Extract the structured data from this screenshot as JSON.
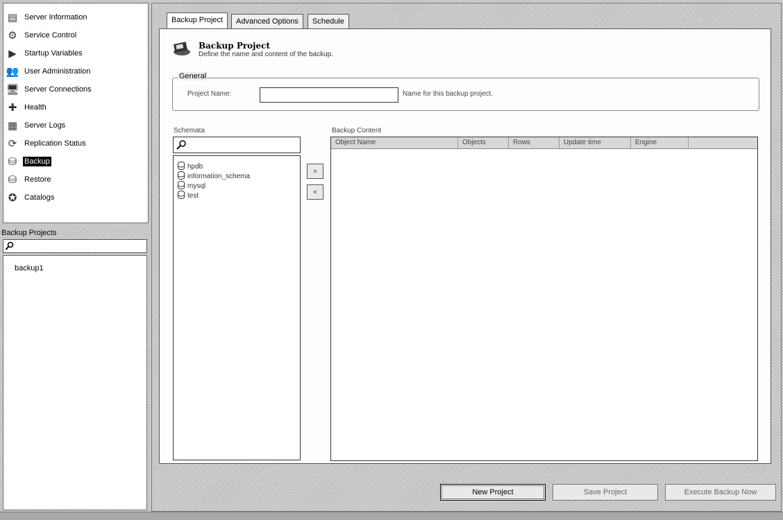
{
  "sidebar": {
    "items": [
      {
        "label": "Server Information",
        "icon": "server-info-icon"
      },
      {
        "label": "Service Control",
        "icon": "service-control-icon"
      },
      {
        "label": "Startup Variables",
        "icon": "startup-variables-icon"
      },
      {
        "label": "User Administration",
        "icon": "users-icon"
      },
      {
        "label": "Server Connections",
        "icon": "connections-icon"
      },
      {
        "label": "Health",
        "icon": "health-icon"
      },
      {
        "label": "Server Logs",
        "icon": "logs-icon"
      },
      {
        "label": "Replication Status",
        "icon": "replication-icon"
      },
      {
        "label": "Backup",
        "icon": "backup-icon",
        "selected": true
      },
      {
        "label": "Restore",
        "icon": "restore-icon"
      },
      {
        "label": "Catalogs",
        "icon": "catalogs-icon"
      }
    ]
  },
  "backup_projects": {
    "label": "Backup Projects",
    "items": [
      "backup1"
    ]
  },
  "tabs": [
    "Backup Project",
    "Advanced Options",
    "Schedule"
  ],
  "header": {
    "title": "Backup Project",
    "subtitle": "Define the name and content of the backup."
  },
  "general": {
    "legend": "General",
    "project_name_label": "Project Name:",
    "project_name_value": "",
    "project_name_hint": "Name for this backup project."
  },
  "schemata": {
    "label": "Schemata",
    "items": [
      "hpdb",
      "information_schema",
      "mysql",
      "test"
    ]
  },
  "backup_content": {
    "label": "Backup Content",
    "columns": [
      "Object Name",
      "Objects",
      "Rows",
      "Update time",
      "Engine"
    ]
  },
  "buttons": {
    "add": ">",
    "remove": "<",
    "new_project": "New Project",
    "save_project": "Save Project",
    "execute_backup": "Execute Backup Now"
  },
  "colors": {
    "selection": "#000000",
    "window_bg": "#c6c6c6"
  }
}
